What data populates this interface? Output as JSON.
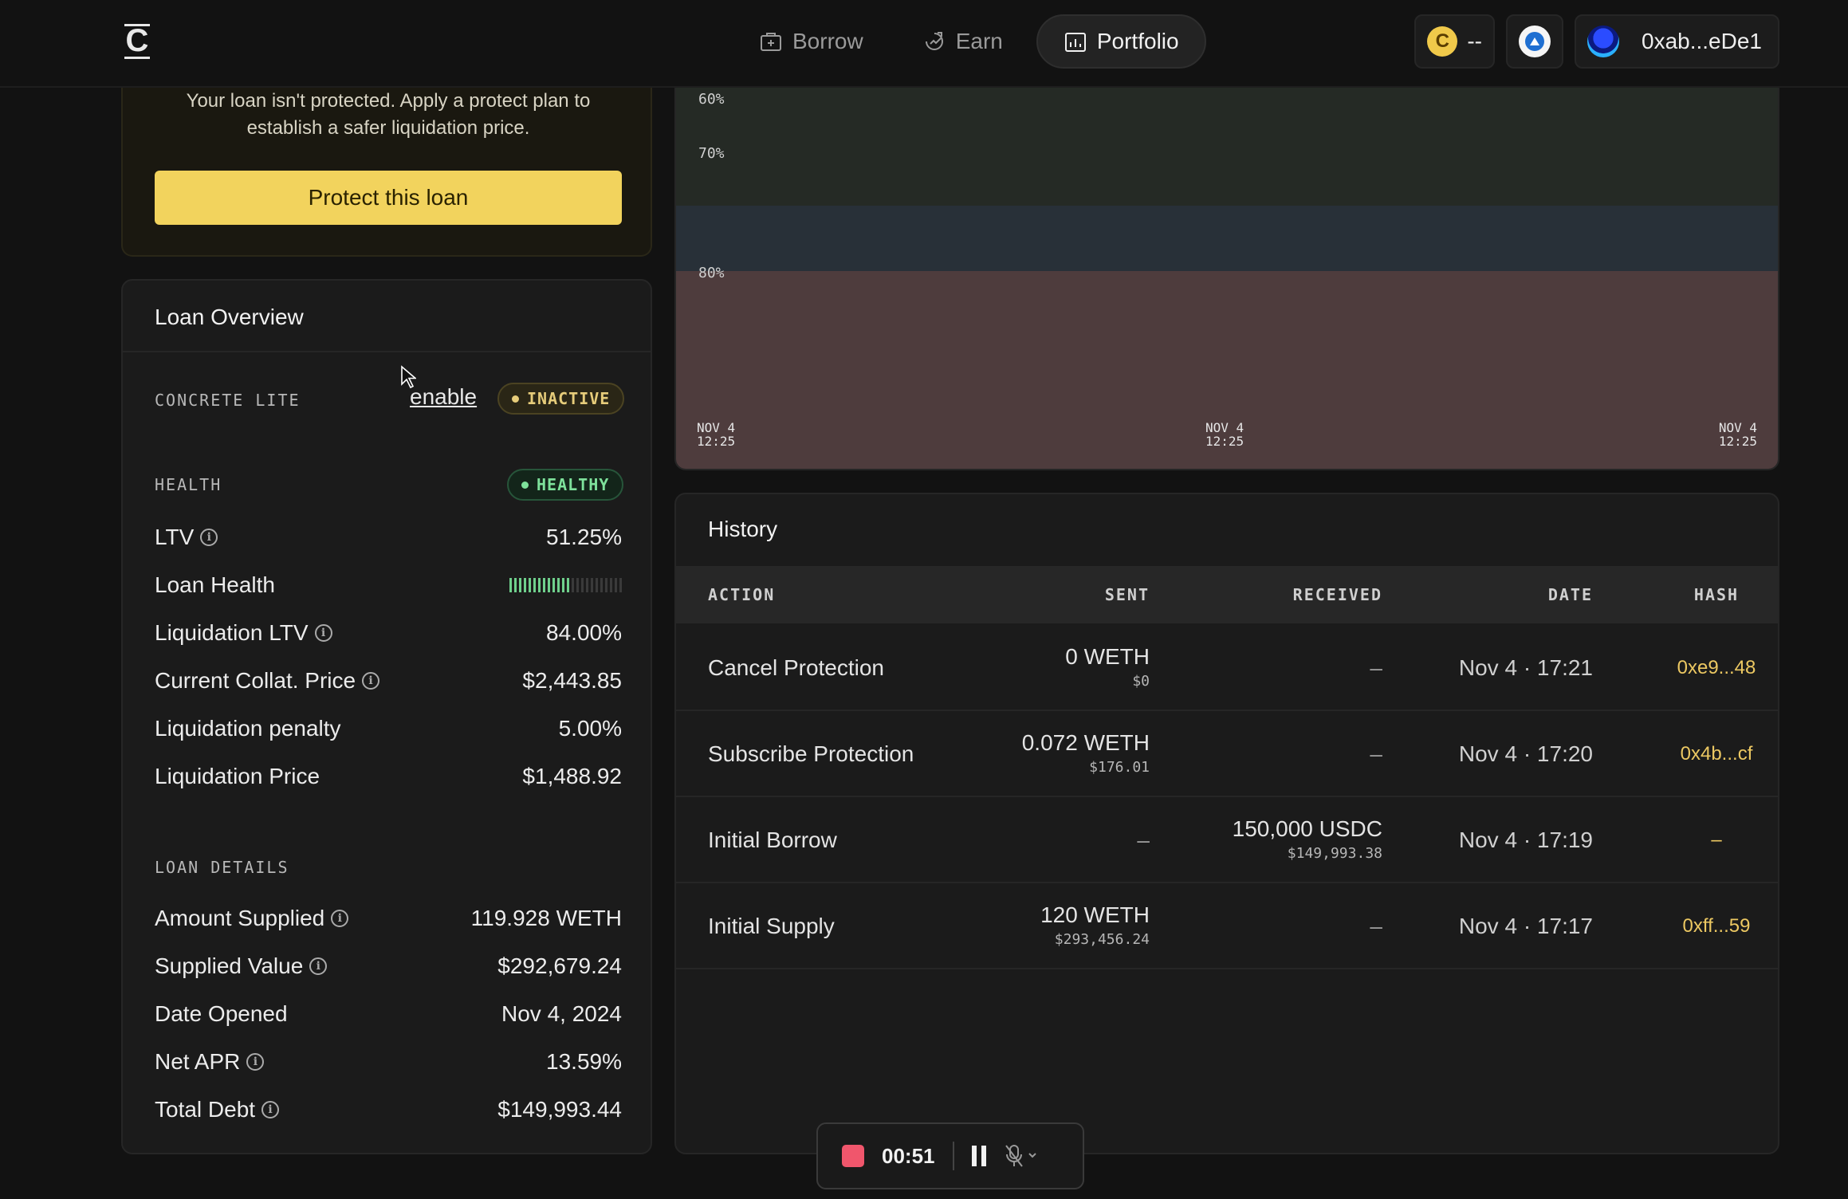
{
  "nav": {
    "logo": "C",
    "items": [
      {
        "label": "Borrow",
        "icon": "borrow-icon",
        "active": false
      },
      {
        "label": "Earn",
        "icon": "earn-icon",
        "active": false
      },
      {
        "label": "Portfolio",
        "icon": "portfolio-icon",
        "active": true
      }
    ],
    "points_value": "--",
    "wallet_address": "0xab...eDe1"
  },
  "protect": {
    "message": "Your loan isn't protected. Apply a protect plan to establish a safer liquidation price.",
    "button_label": "Protect this loan"
  },
  "overview": {
    "title": "Loan Overview",
    "concrete_lite_label": "CONCRETE LITE",
    "enable_label": "enable",
    "inactive_badge": "INACTIVE",
    "health_label": "HEALTH",
    "healthy_badge": "HEALTHY",
    "loan_health_level": 0.55,
    "metrics": [
      {
        "label": "LTV",
        "value": "51.25%",
        "info": true
      },
      {
        "label": "Loan Health",
        "value": "",
        "info": false
      },
      {
        "label": "Liquidation LTV",
        "value": "84.00%",
        "info": true
      },
      {
        "label": "Current Collat. Price",
        "value": "$2,443.85",
        "info": true
      },
      {
        "label": "Liquidation penalty",
        "value": "5.00%",
        "info": false
      },
      {
        "label": "Liquidation Price",
        "value": "$1,488.92",
        "info": false
      }
    ],
    "details_label": "LOAN DETAILS",
    "details": [
      {
        "label": "Amount Supplied",
        "value": "119.928 WETH",
        "info": true
      },
      {
        "label": "Supplied Value",
        "value": "$292,679.24",
        "info": true
      },
      {
        "label": "Date Opened",
        "value": "Nov 4, 2024",
        "info": false
      },
      {
        "label": "Net APR",
        "value": "13.59%",
        "info": true
      },
      {
        "label": "Total Debt",
        "value": "$149,993.44",
        "info": true
      }
    ]
  },
  "chart": {
    "levels": [
      "60%",
      "70%",
      "80%"
    ],
    "x_labels": [
      {
        "date": "NOV 4",
        "time": "12:25"
      },
      {
        "date": "NOV 4",
        "time": "12:25"
      },
      {
        "date": "NOV 4",
        "time": "12:25"
      }
    ],
    "colors": {
      "safe": "#252a25",
      "warning": "#283038",
      "danger": "#4e3c3d"
    }
  },
  "history": {
    "title": "History",
    "columns": [
      "ACTION",
      "SENT",
      "RECEIVED",
      "DATE",
      "HASH"
    ],
    "rows": [
      {
        "action": "Cancel Protection",
        "sent": "0 WETH",
        "sent_usd": "$0",
        "received": "–",
        "received_usd": "",
        "date": "Nov 4 · 17:21",
        "hash": "0xe9...48"
      },
      {
        "action": "Subscribe Protection",
        "sent": "0.072 WETH",
        "sent_usd": "$176.01",
        "received": "–",
        "received_usd": "",
        "date": "Nov 4 · 17:20",
        "hash": "0x4b...cf"
      },
      {
        "action": "Initial Borrow",
        "sent": "–",
        "sent_usd": "",
        "received": "150,000 USDC",
        "received_usd": "$149,993.38",
        "date": "Nov 4 · 17:19",
        "hash": "–"
      },
      {
        "action": "Initial Supply",
        "sent": "120 WETH",
        "sent_usd": "$293,456.24",
        "received": "–",
        "received_usd": "",
        "date": "Nov 4 · 17:17",
        "hash": "0xff...59"
      }
    ]
  },
  "recorder": {
    "elapsed": "00:51",
    "accent": "#f0566c"
  }
}
